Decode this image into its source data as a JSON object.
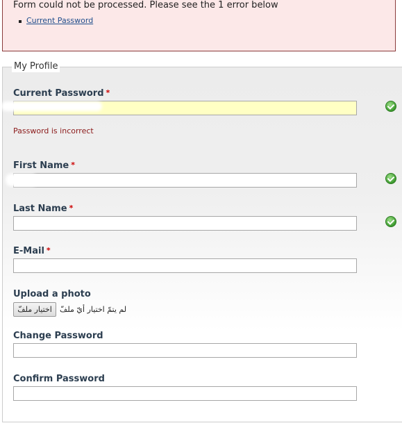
{
  "errors": {
    "message": "Form could not be processed. Please see the 1 error below",
    "items": [
      "Current Password"
    ]
  },
  "form": {
    "legend": "My Profile",
    "required_marker": "*",
    "current_password": {
      "label": "Current Password",
      "value": "",
      "error": "Password is incorrect",
      "valid": true
    },
    "first_name": {
      "label": "First Name",
      "value": "",
      "valid": true
    },
    "last_name": {
      "label": "Last Name",
      "value": "",
      "valid": true
    },
    "email": {
      "label": "E-Mail",
      "value": ""
    },
    "photo": {
      "label": "Upload a photo",
      "button_label": "اختيار ملفّ",
      "status": "لم يتمّ اختيار أيّ ملفّ"
    },
    "change_password": {
      "label": "Change Password",
      "value": ""
    },
    "confirm_password": {
      "label": "Confirm Password",
      "value": ""
    }
  },
  "icons": {
    "valid_check": "check-circle-icon"
  },
  "colors": {
    "error_bg": "#fce8e8",
    "required": "#cc0000",
    "highlight": "#ffffc4",
    "check": "#3c9a2e"
  }
}
